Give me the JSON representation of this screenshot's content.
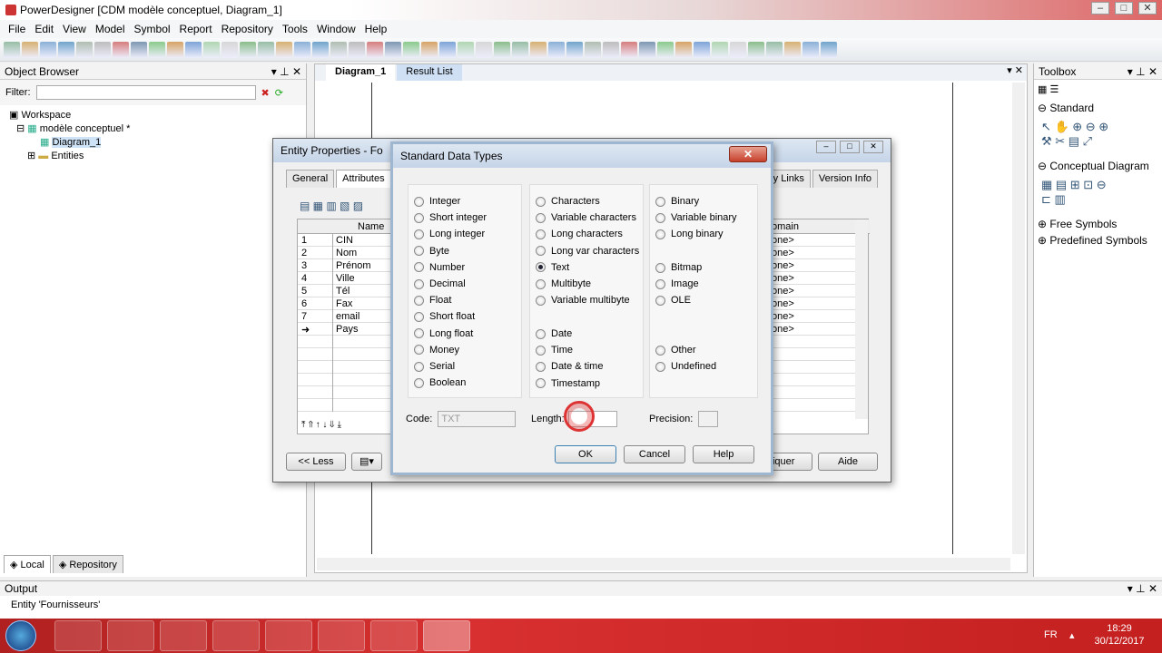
{
  "app": {
    "title": "PowerDesigner [CDM modèle conceptuel, Diagram_1]"
  },
  "menu": [
    "File",
    "Edit",
    "View",
    "Model",
    "Symbol",
    "Report",
    "Repository",
    "Tools",
    "Window",
    "Help"
  ],
  "object_browser": {
    "title": "Object Browser",
    "filter_label": "Filter:",
    "tree": [
      "Workspace",
      "modèle conceptuel *",
      "Diagram_1",
      "Entities"
    ],
    "tabs": [
      "Local",
      "Repository"
    ]
  },
  "doc_tabs": [
    "Diagram_1",
    "Result List"
  ],
  "toolbox": {
    "title": "Toolbox",
    "sections": [
      "Standard",
      "Conceptual Diagram",
      "Free Symbols",
      "Predefined Symbols"
    ]
  },
  "output": {
    "title": "Output",
    "text": "Entity 'Fournisseurs'"
  },
  "entity_dialog": {
    "title": "Entity Properties - Fo",
    "tabs": [
      "General",
      "Attributes",
      "Id"
    ],
    "right_tabs": [
      "lity Links",
      "Version Info"
    ],
    "col_name": "Name",
    "col_domain": "omain",
    "rows": [
      {
        "n": "1",
        "name": "CIN"
      },
      {
        "n": "2",
        "name": "Nom"
      },
      {
        "n": "3",
        "name": "Prénom"
      },
      {
        "n": "4",
        "name": "Ville"
      },
      {
        "n": "5",
        "name": "Tél"
      },
      {
        "n": "6",
        "name": "Fax"
      },
      {
        "n": "7",
        "name": "email"
      },
      {
        "n": "➜",
        "name": "Pays"
      }
    ],
    "domain_val": "one>",
    "less": "<< Less",
    "apply": "liquer",
    "aide": "Aide"
  },
  "sdt": {
    "title": "Standard Data Types",
    "col1": [
      "Integer",
      "Short integer",
      "Long integer",
      "Byte",
      "Number",
      "Decimal",
      "Float",
      "Short float",
      "Long float",
      "Money",
      "Serial",
      "Boolean"
    ],
    "col2a": [
      "Characters",
      "Variable characters",
      "Long characters",
      "Long var characters",
      "Text",
      "Multibyte",
      "Variable multibyte"
    ],
    "col2b": [
      "Date",
      "Time",
      "Date & time",
      "Timestamp"
    ],
    "col3a": [
      "Binary",
      "Variable binary",
      "Long binary"
    ],
    "col3b": [
      "Bitmap",
      "Image",
      "OLE"
    ],
    "col3c": [
      "Other",
      "Undefined"
    ],
    "selected": "Text",
    "code_label": "Code:",
    "code_value": "TXT",
    "length_label": "Length:",
    "precision_label": "Precision:",
    "ok": "OK",
    "cancel": "Cancel",
    "help": "Help"
  },
  "tray": {
    "lang": "FR",
    "time": "18:29",
    "date": "30/12/2017"
  }
}
